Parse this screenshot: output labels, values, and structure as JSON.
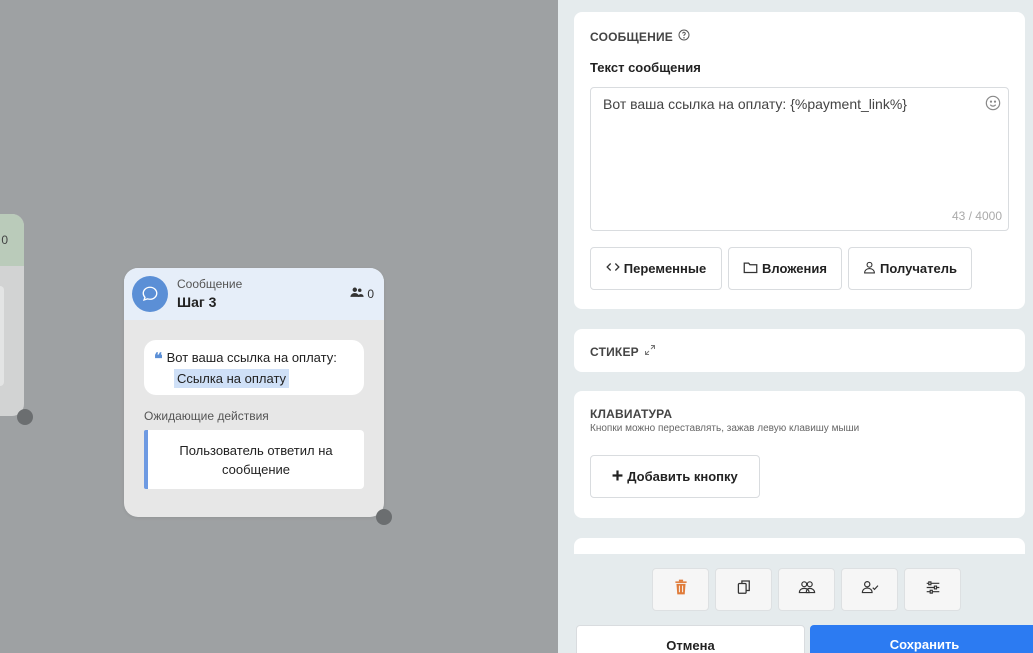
{
  "canvas": {
    "prev_node": {
      "users_count": "0"
    },
    "node": {
      "type": "Сообщение",
      "name": "Шаг 3",
      "users_count": "0",
      "message_text": "Вот ваша ссылка на оплату:",
      "message_link": "Ссылка на оплату",
      "waiting_label": "Ожидающие действия",
      "waiting_action": "Пользователь ответил на сообщение"
    }
  },
  "panel": {
    "message_section": {
      "title": "СООБЩЕНИЕ",
      "field_label": "Текст сообщения",
      "text_value": "Вот ваша ссылка на оплату: {%payment_link%}",
      "counter": "43 / 4000",
      "buttons": {
        "variables": "Переменные",
        "attachments": "Вложения",
        "recipient": "Получатель"
      }
    },
    "sticker_section": {
      "title": "СТИКЕР"
    },
    "keyboard_section": {
      "title": "КЛАВИАТУРА",
      "hint": "Кнопки можно переставлять, зажав левую клавишу мыши",
      "add_button": "Добавить кнопку"
    },
    "footer": {
      "cancel": "Отмена",
      "save": "Сохранить"
    },
    "colors": {
      "accent": "#2c7bf2",
      "node_icon": "#5b8fd6",
      "delete_icon": "#e07b39"
    }
  }
}
